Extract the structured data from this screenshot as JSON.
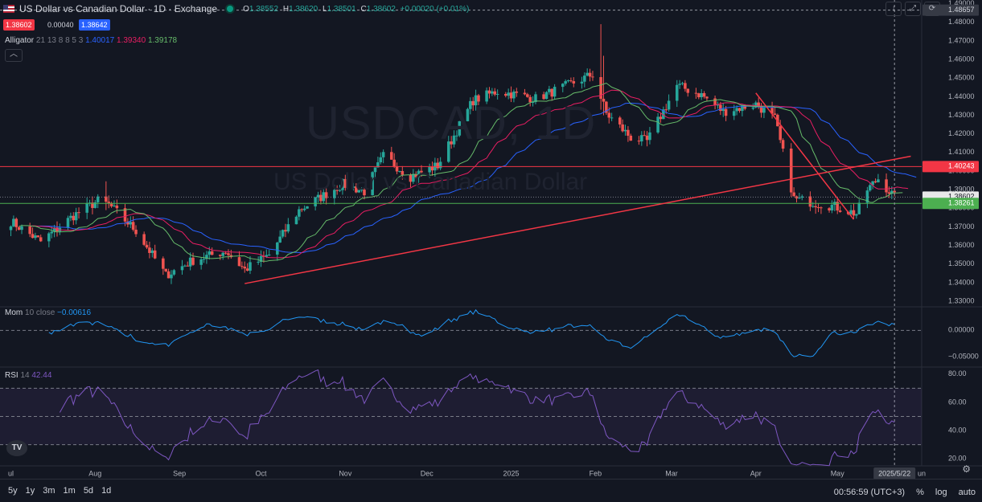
{
  "header": {
    "title": "US Dollar vs Canadian Dollar · 1D · Exchange",
    "ohlc": {
      "o_label": "O",
      "o": "1.38552",
      "h_label": "H",
      "h": "1.38620",
      "l_label": "L",
      "l": "1.38501",
      "c_label": "C",
      "c": "1.38602",
      "change": "+0.00020 (+0.01%)"
    }
  },
  "price_boxes": {
    "bid": "1.38602",
    "spread": "0.00040",
    "ask": "1.38642"
  },
  "watermark": {
    "symbol": "USDCAD, 1D",
    "name": "US Dollar vs Canadian Dollar"
  },
  "indicators": {
    "alligator": {
      "name": "Alligator",
      "params": "21 13 8 8 5 3",
      "jaw": "1.40017",
      "teeth": "1.39340",
      "lips": "1.39178"
    },
    "mom": {
      "name": "Mom",
      "params": "10 close",
      "value": "−0.00616"
    },
    "rsi": {
      "name": "RSI",
      "params": "14",
      "value": "42.44"
    }
  },
  "colors": {
    "bg": "#131722",
    "up": "#26a69a",
    "down": "#ef5350",
    "jaw": "#2962ff",
    "teeth": "#e91e63",
    "lips": "#66bb6a",
    "resistance": "#f23645",
    "support": "#4caf50",
    "mom": "#2196f3",
    "rsi": "#7e57c2"
  },
  "bottom": {
    "timeframes": [
      "5y",
      "1y",
      "3m",
      "1m",
      "5d",
      "1d"
    ],
    "clock": "00:56:59 (UTC+3)",
    "percent": "%",
    "log": "log",
    "auto": "auto"
  },
  "chart_data": {
    "type": "candlestick",
    "price_axis": {
      "ticks": [
        "1.49000",
        "1.48000",
        "1.47000",
        "1.46000",
        "1.45000",
        "1.44000",
        "1.43000",
        "1.42000",
        "1.41000",
        "1.40000",
        "1.39000",
        "1.38000",
        "1.37000",
        "1.36000",
        "1.35000",
        "1.34000",
        "1.33000"
      ],
      "ylim": [
        1.327,
        1.492
      ]
    },
    "mom_axis": {
      "ticks": [
        "0.00000",
        "−0.05000"
      ],
      "ylim": [
        -0.07,
        0.045
      ]
    },
    "rsi_axis": {
      "ticks": [
        "80.00",
        "60.00",
        "40.00",
        "20.00"
      ],
      "ylim": [
        15,
        85
      ],
      "bands": [
        30,
        50,
        70
      ]
    },
    "time_labels": [
      "ul",
      "Aug",
      "Sep",
      "Oct",
      "Nov",
      "Dec",
      "2025",
      "Feb",
      "Mar",
      "Apr",
      "May",
      "2025/5/22",
      "un"
    ],
    "levels": {
      "crosshair": "1.48657",
      "resistance": "1.40243",
      "last": "1.38602",
      "support": "1.38261"
    },
    "trendlines": [
      {
        "from": [
          "2024-09-25",
          1.3395
        ],
        "to": [
          "2025-05-28",
          1.408
        ]
      },
      {
        "from": [
          "2025-04-01",
          1.442
        ],
        "to": [
          "2025-05-07",
          1.374
        ]
      }
    ],
    "anchors": [
      [
        "2024-07-01",
        1.373
      ],
      [
        "2024-07-12",
        1.362
      ],
      [
        "2024-07-24",
        1.376
      ],
      [
        "2024-08-02",
        1.384
      ],
      [
        "2024-08-06",
        1.382
      ],
      [
        "2024-08-16",
        1.368
      ],
      [
        "2024-08-27",
        1.344
      ],
      [
        "2024-09-06",
        1.352
      ],
      [
        "2024-09-18",
        1.357
      ],
      [
        "2024-09-25",
        1.347
      ],
      [
        "2024-10-04",
        1.355
      ],
      [
        "2024-10-15",
        1.379
      ],
      [
        "2024-10-31",
        1.393
      ],
      [
        "2024-11-08",
        1.389
      ],
      [
        "2024-11-15",
        1.408
      ],
      [
        "2024-11-25",
        1.397
      ],
      [
        "2024-12-05",
        1.403
      ],
      [
        "2024-12-18",
        1.438
      ],
      [
        "2024-12-27",
        1.443
      ],
      [
        "2025-01-10",
        1.439
      ],
      [
        "2025-01-20",
        1.445
      ],
      [
        "2025-01-31",
        1.452
      ],
      [
        "2025-02-05",
        1.431
      ],
      [
        "2025-02-14",
        1.418
      ],
      [
        "2025-02-20",
        1.416
      ],
      [
        "2025-03-03",
        1.446
      ],
      [
        "2025-03-12",
        1.441
      ],
      [
        "2025-03-20",
        1.432
      ],
      [
        "2025-04-01",
        1.436
      ],
      [
        "2025-04-08",
        1.428
      ],
      [
        "2025-04-15",
        1.385
      ],
      [
        "2025-04-30",
        1.381
      ],
      [
        "2025-05-08",
        1.377
      ],
      [
        "2025-05-12",
        1.39
      ],
      [
        "2025-05-16",
        1.396
      ],
      [
        "2025-05-22",
        1.386
      ]
    ],
    "wicks": [
      [
        "2024-08-05",
        1.3945,
        1.379
      ],
      [
        "2025-02-03",
        1.479,
        1.433
      ],
      [
        "2025-02-04",
        1.462,
        1.43
      ]
    ]
  }
}
